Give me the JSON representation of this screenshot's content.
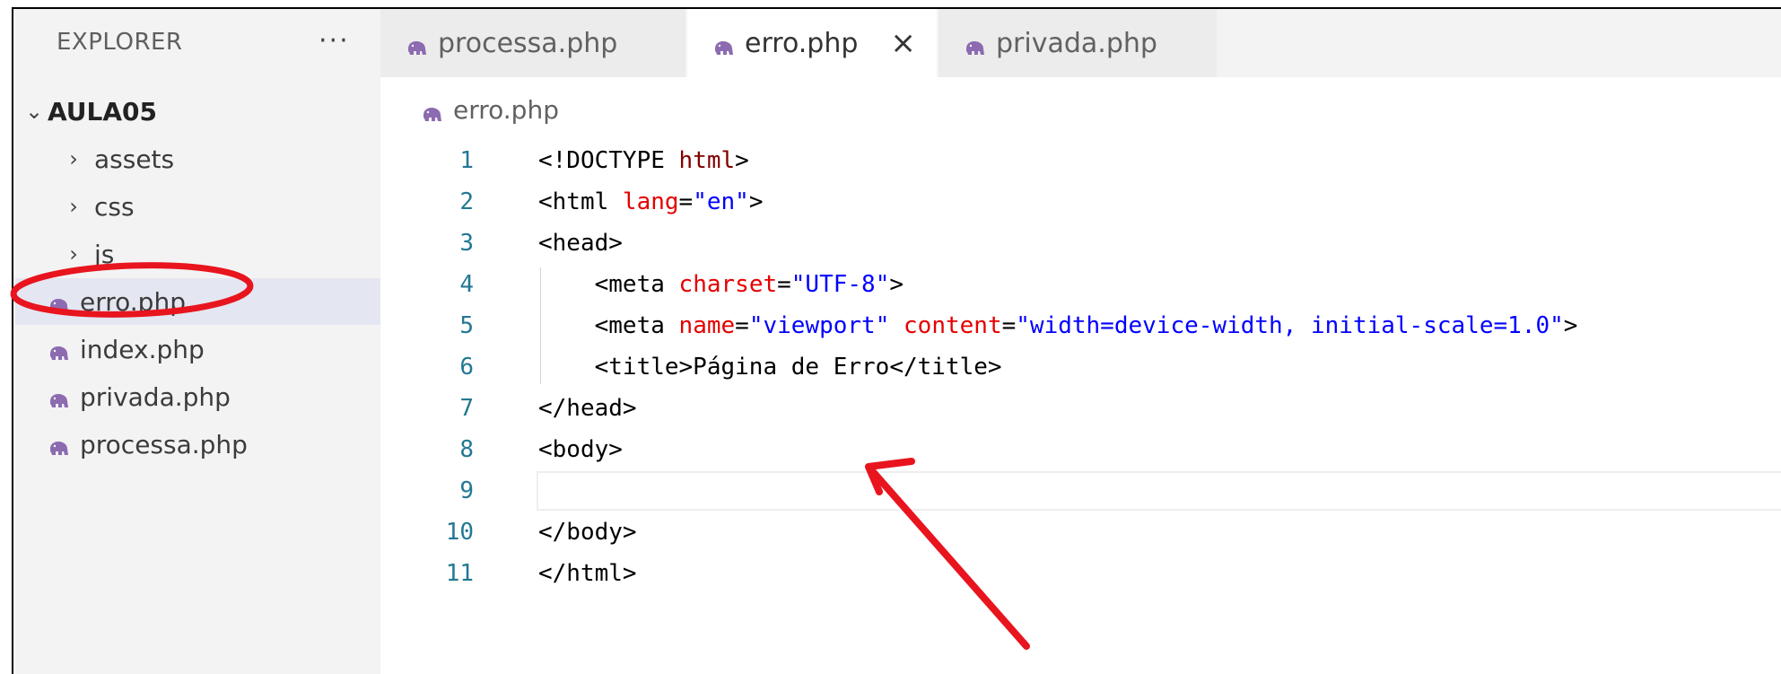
{
  "sidebar": {
    "title": "EXPLORER",
    "more": "···",
    "folder": "AULA05",
    "items": [
      {
        "type": "folder",
        "label": "assets"
      },
      {
        "type": "folder",
        "label": "css"
      },
      {
        "type": "folder",
        "label": "js"
      },
      {
        "type": "file",
        "label": "erro.php",
        "selected": true
      },
      {
        "type": "file",
        "label": "index.php"
      },
      {
        "type": "file",
        "label": "privada.php"
      },
      {
        "type": "file",
        "label": "processa.php"
      }
    ]
  },
  "tabs": [
    {
      "label": "processa.php",
      "active": false
    },
    {
      "label": "erro.php",
      "active": true,
      "close": "×"
    },
    {
      "label": "privada.php",
      "active": false
    }
  ],
  "breadcrumb": "erro.php",
  "editor": {
    "current_line": 9,
    "lines": [
      {
        "n": "1",
        "tokens": [
          [
            "t",
            "<!DOCTYPE "
          ],
          [
            "tag",
            "html"
          ],
          [
            "t",
            ">"
          ]
        ]
      },
      {
        "n": "2",
        "tokens": [
          [
            "t",
            "<html "
          ],
          [
            "attr",
            "lang"
          ],
          [
            "t",
            "="
          ],
          [
            "val",
            "\"en\""
          ],
          [
            "t",
            ">"
          ]
        ]
      },
      {
        "n": "3",
        "tokens": [
          [
            "t",
            "<head>"
          ]
        ]
      },
      {
        "n": "4",
        "tokens": [
          [
            "t",
            "    <meta "
          ],
          [
            "attr",
            "charset"
          ],
          [
            "t",
            "="
          ],
          [
            "val",
            "\"UTF-8\""
          ],
          [
            "t",
            ">"
          ]
        ]
      },
      {
        "n": "5",
        "tokens": [
          [
            "t",
            "    <meta "
          ],
          [
            "attr",
            "name"
          ],
          [
            "t",
            "="
          ],
          [
            "val",
            "\"viewport\""
          ],
          [
            "t",
            " "
          ],
          [
            "attr",
            "content"
          ],
          [
            "t",
            "="
          ],
          [
            "val",
            "\"width=device-width, initial-scale=1.0\""
          ],
          [
            "t",
            ">"
          ]
        ]
      },
      {
        "n": "6",
        "tokens": [
          [
            "t",
            "    <title>Página de Erro</title>"
          ]
        ]
      },
      {
        "n": "7",
        "tokens": [
          [
            "t",
            "</head>"
          ]
        ]
      },
      {
        "n": "8",
        "tokens": [
          [
            "t",
            "<body>"
          ]
        ]
      },
      {
        "n": "9",
        "tokens": []
      },
      {
        "n": "10",
        "tokens": [
          [
            "t",
            "</body>"
          ]
        ]
      },
      {
        "n": "11",
        "tokens": [
          [
            "t",
            "</html>"
          ]
        ]
      }
    ]
  },
  "colors": {
    "annotation": "#e8141e",
    "php_icon": "#8c6bb1"
  }
}
